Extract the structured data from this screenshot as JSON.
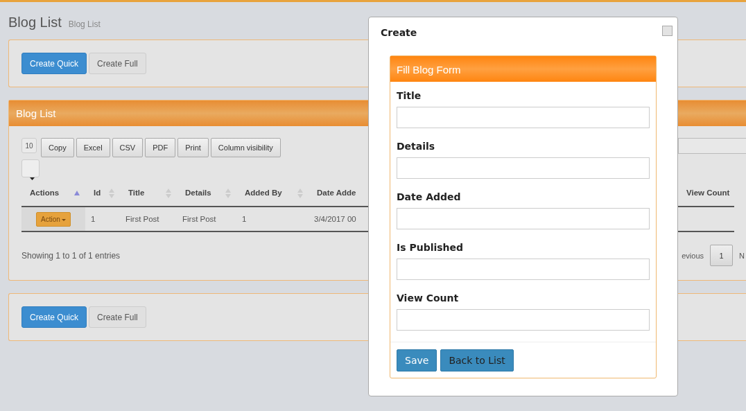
{
  "page": {
    "title": "Blog List",
    "subtitle": "Blog List"
  },
  "top_actions": [
    {
      "label": "Create Quick",
      "primary": true
    },
    {
      "label": "Create Full",
      "primary": false
    }
  ],
  "list_panel": {
    "title": "Blog List",
    "page_length": "10",
    "export_buttons": [
      "Copy",
      "Excel",
      "CSV",
      "PDF",
      "Print",
      "Column visibility"
    ],
    "columns": [
      {
        "label": "Actions",
        "sorted": true
      },
      {
        "label": "Id",
        "sorted": false
      },
      {
        "label": "Title",
        "sorted": false
      },
      {
        "label": "Details",
        "sorted": false
      },
      {
        "label": "Added By",
        "sorted": false
      },
      {
        "label": "Date Adde"
      },
      {
        "label": "View Count"
      }
    ],
    "rows": [
      {
        "cells": [
          "Action",
          "1",
          "First Post",
          "First Post",
          "1",
          "3/4/2017 00",
          ""
        ]
      }
    ],
    "info": "Showing 1 to 1 of 1 entries",
    "pagination": {
      "previous": "evious",
      "pages": [
        {
          "label": "1",
          "selected": true
        }
      ],
      "next": "N"
    }
  },
  "bottom_actions": [
    {
      "label": "Create Quick",
      "primary": true
    },
    {
      "label": "Create Full",
      "primary": false
    }
  ],
  "dialog": {
    "title": "Create",
    "form": {
      "title": "Fill Blog Form",
      "fields": [
        {
          "label": "Title"
        },
        {
          "label": "Details"
        },
        {
          "label": "Date Added"
        },
        {
          "label": "Is Published"
        },
        {
          "label": "View Count"
        }
      ],
      "buttons": [
        {
          "label": "Save",
          "primary": true
        },
        {
          "label": "Back to List",
          "primary": false
        }
      ]
    }
  }
}
